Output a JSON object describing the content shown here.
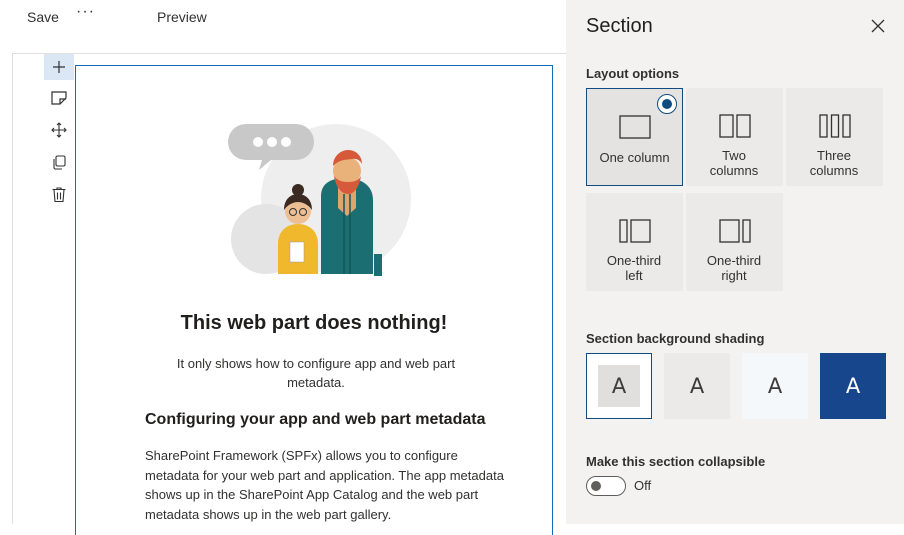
{
  "toolbar": {
    "save_label": "Save",
    "more_label": "···",
    "preview_label": "Preview"
  },
  "toolstrip": {
    "icons": [
      "add-icon",
      "edit-icon",
      "move-icon",
      "duplicate-icon",
      "delete-icon"
    ]
  },
  "webpart": {
    "title": "This web part does nothing!",
    "subtitle": "It only shows how to configure app and web part metadata.",
    "heading": "Configuring your app and web part metadata",
    "body": "SharePoint Framework (SPFx) allows you to configure metadata for your web part and application. The app metadata shows up in the SharePoint App Catalog and the web part metadata shows up in the web part gallery."
  },
  "panel": {
    "title": "Section",
    "layout_label": "Layout options",
    "layouts": [
      {
        "label": "One column",
        "selected": true
      },
      {
        "label": "Two columns",
        "selected": false
      },
      {
        "label": "Three columns",
        "selected": false
      },
      {
        "label": "One-third left",
        "selected": false
      },
      {
        "label": "One-third right",
        "selected": false
      }
    ],
    "shading_label": "Section background shading",
    "shading_glyph": "A",
    "shading_colors": [
      "#e0dfdd",
      "#ebeae8",
      "#f5f8fb",
      "#17468d"
    ],
    "collapsible_label": "Make this section collapsible",
    "collapsible_state": "Off"
  },
  "colors": {
    "accent": "#0f4c81",
    "selection_border": "#0f6cbd",
    "dark_shade": "#17468d"
  }
}
